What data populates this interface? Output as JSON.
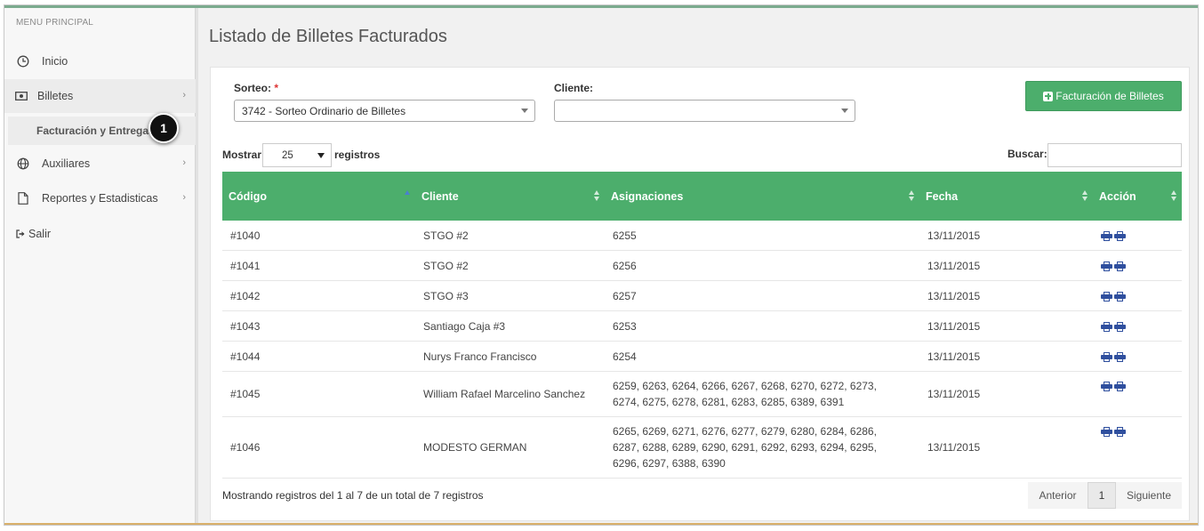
{
  "sidebar": {
    "title": "MENU PRINCIPAL",
    "items": [
      {
        "label": "Inicio",
        "icon": "clock-icon"
      },
      {
        "label": "Billetes",
        "icon": "money-icon"
      },
      {
        "label": "Auxiliares",
        "icon": "globe-icon"
      },
      {
        "label": "Reportes y Estadisticas",
        "icon": "file-icon"
      },
      {
        "label": "Salir",
        "icon": "sign-out-icon"
      }
    ],
    "subitem": "Facturación y Entregas",
    "step_badge": "1"
  },
  "page": {
    "title": "Listado de Billetes Facturados"
  },
  "filters": {
    "sorteo_label": "Sorteo:",
    "sorteo_required": "*",
    "sorteo_value": "3742 - Sorteo Ordinario de Billetes",
    "cliente_label": "Cliente:",
    "cliente_value": ""
  },
  "actions": {
    "new_button": "Facturación de Billetes"
  },
  "table_controls": {
    "show_label": "Mostrar",
    "page_length": "25",
    "records_label": "registros",
    "search_label": "Buscar:",
    "search_value": ""
  },
  "table": {
    "columns": [
      "Código",
      "Cliente",
      "Asignaciones",
      "Fecha",
      "Acción"
    ],
    "rows": [
      {
        "codigo": "#1040",
        "cliente": "STGO #2",
        "asignaciones": "6255",
        "fecha": "13/11/2015"
      },
      {
        "codigo": "#1041",
        "cliente": "STGO #2",
        "asignaciones": "6256",
        "fecha": "13/11/2015"
      },
      {
        "codigo": "#1042",
        "cliente": "STGO #3",
        "asignaciones": "6257",
        "fecha": "13/11/2015"
      },
      {
        "codigo": "#1043",
        "cliente": "Santiago Caja #3",
        "asignaciones": "6253",
        "fecha": "13/11/2015"
      },
      {
        "codigo": "#1044",
        "cliente": "Nurys Franco Francisco",
        "asignaciones": "6254",
        "fecha": "13/11/2015"
      },
      {
        "codigo": "#1045",
        "cliente": "William Rafael Marcelino Sanchez",
        "asignaciones": "6259, 6263, 6264, 6266, 6267, 6268, 6270, 6272, 6273, 6274, 6275, 6278, 6281, 6283, 6285, 6389, 6391",
        "fecha": "13/11/2015"
      },
      {
        "codigo": "#1046",
        "cliente": "MODESTO GERMAN",
        "asignaciones": "6265, 6269, 6271, 6276, 6277, 6279, 6280, 6284, 6286, 6287, 6288, 6289, 6290, 6291, 6292, 6293, 6294, 6295, 6296, 6297, 6388, 6390",
        "fecha": "13/11/2015"
      }
    ]
  },
  "footer": {
    "info": "Mostrando registros del 1 al 7 de un total de 7 registros",
    "prev": "Anterior",
    "page": "1",
    "next": "Siguiente"
  }
}
